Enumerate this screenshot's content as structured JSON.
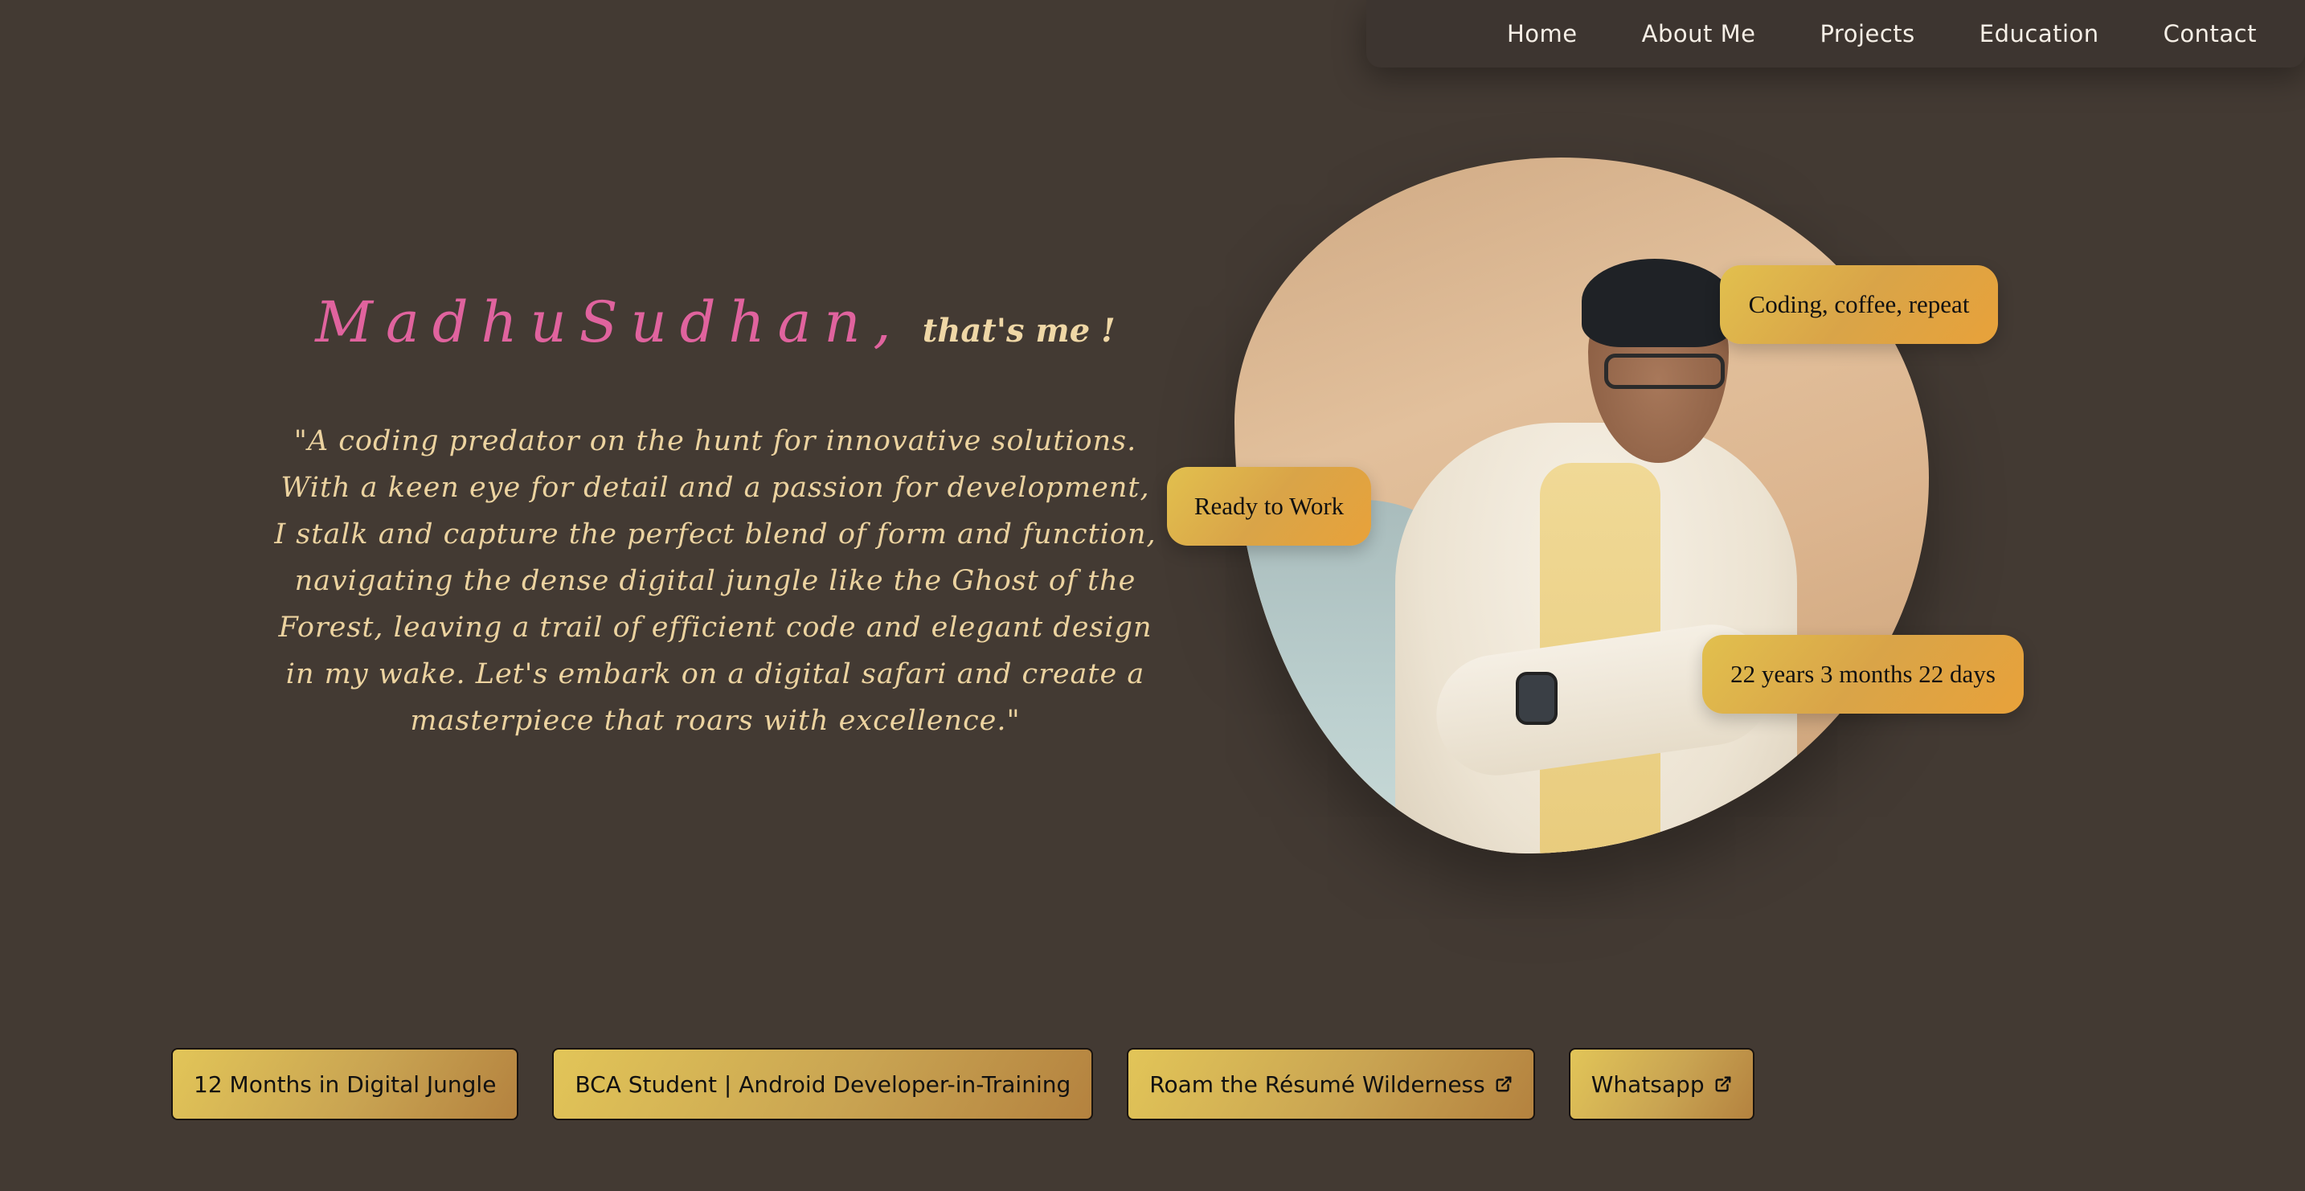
{
  "nav": {
    "items": [
      "Home",
      "About Me",
      "Projects",
      "Education",
      "Contact"
    ]
  },
  "hero": {
    "name": "MadhuSudhan,",
    "suffix": "that's me !",
    "quote": "\"A coding predator on the hunt for innovative solutions. With a keen eye for detail and a passion for development, I stalk and capture the perfect blend of form and function, navigating the dense digital jungle like the Ghost of the Forest, leaving a trail of efficient code and elegant design in my wake. Let's embark on a digital safari and create a masterpiece that roars with excellence.\""
  },
  "badges": {
    "coding": "Coding, coffee, repeat",
    "ready": "Ready to Work",
    "age": "22 years 3 months 22 days"
  },
  "buttons": {
    "experience": "12 Months in Digital Jungle",
    "student": "BCA Student | Android Developer-in-Training",
    "resume": "Roam the Résumé Wilderness",
    "whatsapp": "Whatsapp"
  },
  "colors": {
    "background": "#433a33",
    "accent_name": "#e0639e",
    "text_cream": "#ecd3a0",
    "badge_gold": "#e2c04e"
  },
  "icons": {
    "external_link": "external-link-icon"
  }
}
